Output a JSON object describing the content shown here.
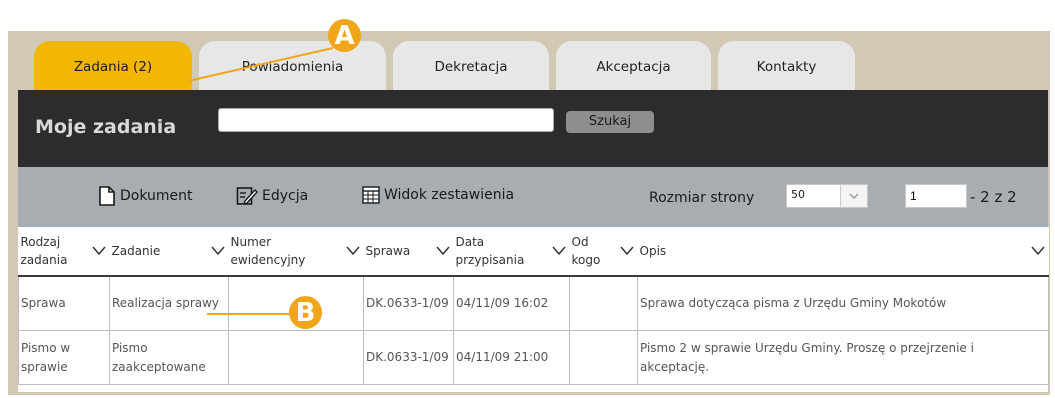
{
  "tabs": [
    {
      "label": "Zadania (2)",
      "active": true
    },
    {
      "label": "Powiadomienia",
      "active": false
    },
    {
      "label": "Dekretacja",
      "active": false
    },
    {
      "label": "Akceptacja",
      "active": false
    },
    {
      "label": "Kontakty",
      "active": false
    }
  ],
  "header": {
    "title": "Moje zadania",
    "search_value": "",
    "search_button": "Szukaj"
  },
  "toolbar": {
    "document_label": "Dokument",
    "edit_label": "Edycja",
    "summary_label": "Widok zestawienia",
    "page_size_label": "Rozmiar strony",
    "page_size_value": "50",
    "page_value": "1",
    "page_total": "- 2 z 2"
  },
  "table": {
    "columns": [
      "Rodzaj zadania",
      "Zadanie",
      "Numer ewidencyjny",
      "Sprawa",
      "Data przypisania",
      "Od kogo",
      "Opis"
    ],
    "rows": [
      [
        "Sprawa",
        "Realizacja sprawy",
        "",
        "DK.0633-1/09",
        "04/11/09 16:02",
        "",
        "Sprawa dotycząca pisma z Urzędu Gminy Mokotów"
      ],
      [
        "Pismo w sprawie",
        "Pismo zaakceptowane",
        "",
        "DK.0633-1/09",
        "04/11/09 21:00",
        "",
        "Pismo 2 w sprawie Urzędu Gminy. Proszę o przejrzenie i akceptację."
      ]
    ]
  },
  "callouts": {
    "a": "A",
    "b": "B"
  },
  "colors": {
    "accent": "#f2b705",
    "callout": "#f0a51a",
    "header_bg": "#2e2b2e",
    "toolbar_bg": "#a8adb1"
  }
}
